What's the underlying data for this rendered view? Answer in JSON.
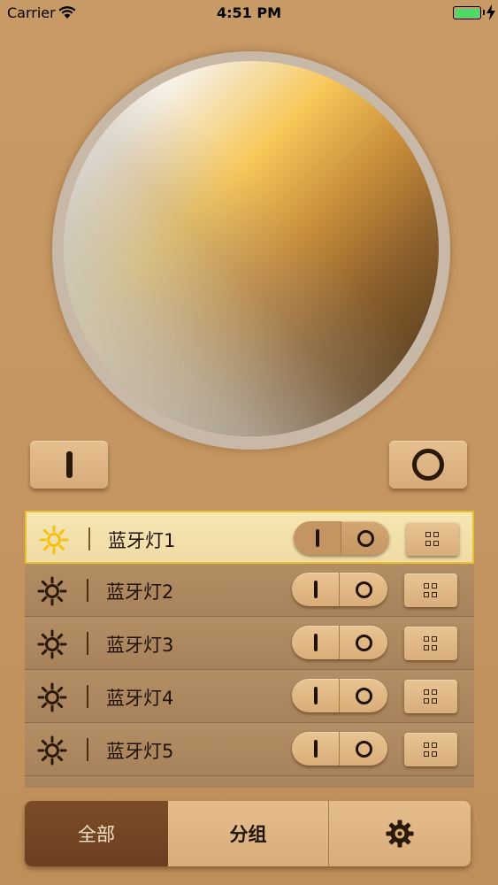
{
  "status_bar": {
    "carrier": "Carrier",
    "time": "4:51 PM",
    "battery_level": 1.0
  },
  "controls": {
    "all_on_icon": "power-on-bar-icon",
    "all_off_icon": "power-off-ring-icon"
  },
  "devices": [
    {
      "label": "蓝牙灯1",
      "selected": true
    },
    {
      "label": "蓝牙灯2",
      "selected": false
    },
    {
      "label": "蓝牙灯3",
      "selected": false
    },
    {
      "label": "蓝牙灯4",
      "selected": false
    },
    {
      "label": "蓝牙灯5",
      "selected": false
    }
  ],
  "tabbar": {
    "all_label": "全部",
    "group_label": "分组",
    "settings_icon": "gear-icon",
    "active_tab": "all"
  },
  "colors": {
    "selected_border": "#e9c02e",
    "active_tab": "#6b3f1f",
    "background": "#c49560"
  }
}
